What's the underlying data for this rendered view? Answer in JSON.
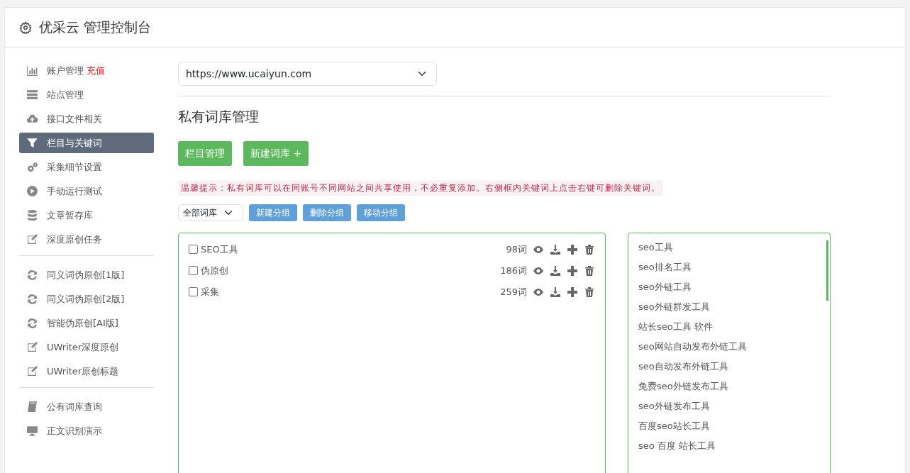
{
  "header": {
    "title": "优采云 管理控制台"
  },
  "sidebar": {
    "groups": [
      {
        "items": [
          {
            "label": "账户管理",
            "extra": "充值",
            "selected": false
          },
          {
            "label": "站点管理",
            "selected": false
          },
          {
            "label": "接口文件相关",
            "selected": false
          },
          {
            "label": "栏目与关键词",
            "selected": true
          },
          {
            "label": "采集细节设置",
            "selected": false
          },
          {
            "label": "手动运行测试",
            "selected": false
          },
          {
            "label": "文章暂存库",
            "selected": false
          },
          {
            "label": "深度原创任务",
            "selected": false
          }
        ]
      },
      {
        "items": [
          {
            "label": "同义词伪原创[1版]",
            "selected": false
          },
          {
            "label": "同义词伪原创[2版]",
            "selected": false
          },
          {
            "label": "智能伪原创[AI版]",
            "selected": false
          },
          {
            "label": "UWriter深度原创",
            "selected": false
          },
          {
            "label": "UWriter原创标题",
            "selected": false
          }
        ]
      },
      {
        "items": [
          {
            "label": "公有词库查询",
            "selected": false
          },
          {
            "label": "正文识别演示",
            "selected": false
          }
        ]
      }
    ]
  },
  "site_select": {
    "value": "https://www.ucaiyun.com"
  },
  "page_title": "私有词库管理",
  "top_buttons": [
    "栏目管理",
    "新建词库 +"
  ],
  "hint": "温馨提示：私有词库可以在同账号不同网站之间共享使用，不必重复添加。右侧框内关键词上点击右键可删除关键词。",
  "group_select": {
    "value": "全部词库"
  },
  "group_buttons": [
    "新建分组",
    "删除分组",
    "移动分组"
  ],
  "libraries": [
    {
      "name": "SEO工具",
      "count": "98词",
      "checked": false
    },
    {
      "name": "伪原创",
      "count": "186词",
      "checked": false
    },
    {
      "name": "采集",
      "count": "259词",
      "checked": false
    }
  ],
  "keywords": [
    "seo工具",
    "seo排名工具",
    "seo外链工具",
    "seo外链群发工具",
    "站长seo工具 软件",
    "seo网站自动发布外链工具",
    "seo自动发布外链工具",
    "免费seo外链发布工具",
    "seo外链发布工具",
    "百度seo站长工具",
    "seo 百度 站长工具"
  ]
}
